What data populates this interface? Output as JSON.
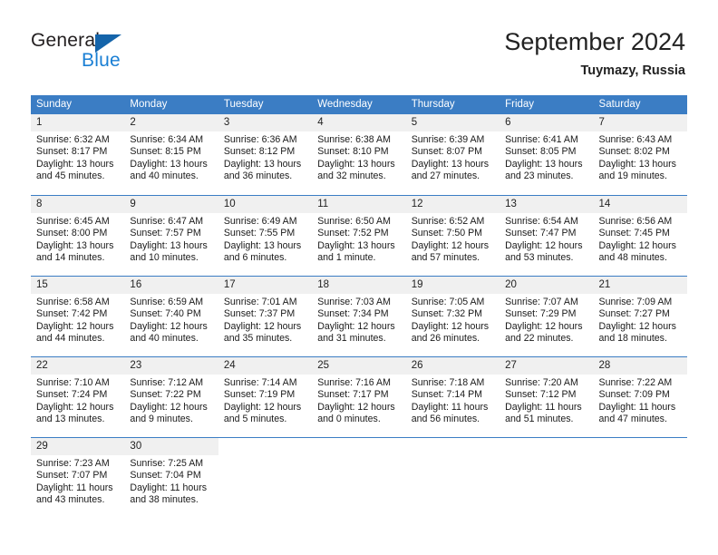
{
  "brand": {
    "name_part1": "General",
    "name_part2": "Blue",
    "triangle_icon": "triangle-logo-icon",
    "color_dark": "#231f20",
    "color_blue": "#1a7fd4"
  },
  "header": {
    "title": "September 2024",
    "subtitle": "Tuymazy, Russia"
  },
  "theme": {
    "header_bar": "#3b7dc4",
    "day_band": "#f0f0f0",
    "text": "#1a1a1a"
  },
  "weekdays": [
    "Sunday",
    "Monday",
    "Tuesday",
    "Wednesday",
    "Thursday",
    "Friday",
    "Saturday"
  ],
  "weeks": [
    [
      {
        "day": "1",
        "sunrise": "Sunrise: 6:32 AM",
        "sunset": "Sunset: 8:17 PM",
        "daylight1": "Daylight: 13 hours",
        "daylight2": "and 45 minutes."
      },
      {
        "day": "2",
        "sunrise": "Sunrise: 6:34 AM",
        "sunset": "Sunset: 8:15 PM",
        "daylight1": "Daylight: 13 hours",
        "daylight2": "and 40 minutes."
      },
      {
        "day": "3",
        "sunrise": "Sunrise: 6:36 AM",
        "sunset": "Sunset: 8:12 PM",
        "daylight1": "Daylight: 13 hours",
        "daylight2": "and 36 minutes."
      },
      {
        "day": "4",
        "sunrise": "Sunrise: 6:38 AM",
        "sunset": "Sunset: 8:10 PM",
        "daylight1": "Daylight: 13 hours",
        "daylight2": "and 32 minutes."
      },
      {
        "day": "5",
        "sunrise": "Sunrise: 6:39 AM",
        "sunset": "Sunset: 8:07 PM",
        "daylight1": "Daylight: 13 hours",
        "daylight2": "and 27 minutes."
      },
      {
        "day": "6",
        "sunrise": "Sunrise: 6:41 AM",
        "sunset": "Sunset: 8:05 PM",
        "daylight1": "Daylight: 13 hours",
        "daylight2": "and 23 minutes."
      },
      {
        "day": "7",
        "sunrise": "Sunrise: 6:43 AM",
        "sunset": "Sunset: 8:02 PM",
        "daylight1": "Daylight: 13 hours",
        "daylight2": "and 19 minutes."
      }
    ],
    [
      {
        "day": "8",
        "sunrise": "Sunrise: 6:45 AM",
        "sunset": "Sunset: 8:00 PM",
        "daylight1": "Daylight: 13 hours",
        "daylight2": "and 14 minutes."
      },
      {
        "day": "9",
        "sunrise": "Sunrise: 6:47 AM",
        "sunset": "Sunset: 7:57 PM",
        "daylight1": "Daylight: 13 hours",
        "daylight2": "and 10 minutes."
      },
      {
        "day": "10",
        "sunrise": "Sunrise: 6:49 AM",
        "sunset": "Sunset: 7:55 PM",
        "daylight1": "Daylight: 13 hours",
        "daylight2": "and 6 minutes."
      },
      {
        "day": "11",
        "sunrise": "Sunrise: 6:50 AM",
        "sunset": "Sunset: 7:52 PM",
        "daylight1": "Daylight: 13 hours",
        "daylight2": "and 1 minute."
      },
      {
        "day": "12",
        "sunrise": "Sunrise: 6:52 AM",
        "sunset": "Sunset: 7:50 PM",
        "daylight1": "Daylight: 12 hours",
        "daylight2": "and 57 minutes."
      },
      {
        "day": "13",
        "sunrise": "Sunrise: 6:54 AM",
        "sunset": "Sunset: 7:47 PM",
        "daylight1": "Daylight: 12 hours",
        "daylight2": "and 53 minutes."
      },
      {
        "day": "14",
        "sunrise": "Sunrise: 6:56 AM",
        "sunset": "Sunset: 7:45 PM",
        "daylight1": "Daylight: 12 hours",
        "daylight2": "and 48 minutes."
      }
    ],
    [
      {
        "day": "15",
        "sunrise": "Sunrise: 6:58 AM",
        "sunset": "Sunset: 7:42 PM",
        "daylight1": "Daylight: 12 hours",
        "daylight2": "and 44 minutes."
      },
      {
        "day": "16",
        "sunrise": "Sunrise: 6:59 AM",
        "sunset": "Sunset: 7:40 PM",
        "daylight1": "Daylight: 12 hours",
        "daylight2": "and 40 minutes."
      },
      {
        "day": "17",
        "sunrise": "Sunrise: 7:01 AM",
        "sunset": "Sunset: 7:37 PM",
        "daylight1": "Daylight: 12 hours",
        "daylight2": "and 35 minutes."
      },
      {
        "day": "18",
        "sunrise": "Sunrise: 7:03 AM",
        "sunset": "Sunset: 7:34 PM",
        "daylight1": "Daylight: 12 hours",
        "daylight2": "and 31 minutes."
      },
      {
        "day": "19",
        "sunrise": "Sunrise: 7:05 AM",
        "sunset": "Sunset: 7:32 PM",
        "daylight1": "Daylight: 12 hours",
        "daylight2": "and 26 minutes."
      },
      {
        "day": "20",
        "sunrise": "Sunrise: 7:07 AM",
        "sunset": "Sunset: 7:29 PM",
        "daylight1": "Daylight: 12 hours",
        "daylight2": "and 22 minutes."
      },
      {
        "day": "21",
        "sunrise": "Sunrise: 7:09 AM",
        "sunset": "Sunset: 7:27 PM",
        "daylight1": "Daylight: 12 hours",
        "daylight2": "and 18 minutes."
      }
    ],
    [
      {
        "day": "22",
        "sunrise": "Sunrise: 7:10 AM",
        "sunset": "Sunset: 7:24 PM",
        "daylight1": "Daylight: 12 hours",
        "daylight2": "and 13 minutes."
      },
      {
        "day": "23",
        "sunrise": "Sunrise: 7:12 AM",
        "sunset": "Sunset: 7:22 PM",
        "daylight1": "Daylight: 12 hours",
        "daylight2": "and 9 minutes."
      },
      {
        "day": "24",
        "sunrise": "Sunrise: 7:14 AM",
        "sunset": "Sunset: 7:19 PM",
        "daylight1": "Daylight: 12 hours",
        "daylight2": "and 5 minutes."
      },
      {
        "day": "25",
        "sunrise": "Sunrise: 7:16 AM",
        "sunset": "Sunset: 7:17 PM",
        "daylight1": "Daylight: 12 hours",
        "daylight2": "and 0 minutes."
      },
      {
        "day": "26",
        "sunrise": "Sunrise: 7:18 AM",
        "sunset": "Sunset: 7:14 PM",
        "daylight1": "Daylight: 11 hours",
        "daylight2": "and 56 minutes."
      },
      {
        "day": "27",
        "sunrise": "Sunrise: 7:20 AM",
        "sunset": "Sunset: 7:12 PM",
        "daylight1": "Daylight: 11 hours",
        "daylight2": "and 51 minutes."
      },
      {
        "day": "28",
        "sunrise": "Sunrise: 7:22 AM",
        "sunset": "Sunset: 7:09 PM",
        "daylight1": "Daylight: 11 hours",
        "daylight2": "and 47 minutes."
      }
    ],
    [
      {
        "day": "29",
        "sunrise": "Sunrise: 7:23 AM",
        "sunset": "Sunset: 7:07 PM",
        "daylight1": "Daylight: 11 hours",
        "daylight2": "and 43 minutes."
      },
      {
        "day": "30",
        "sunrise": "Sunrise: 7:25 AM",
        "sunset": "Sunset: 7:04 PM",
        "daylight1": "Daylight: 11 hours",
        "daylight2": "and 38 minutes."
      },
      {
        "day": "",
        "sunrise": "",
        "sunset": "",
        "daylight1": "",
        "daylight2": ""
      },
      {
        "day": "",
        "sunrise": "",
        "sunset": "",
        "daylight1": "",
        "daylight2": ""
      },
      {
        "day": "",
        "sunrise": "",
        "sunset": "",
        "daylight1": "",
        "daylight2": ""
      },
      {
        "day": "",
        "sunrise": "",
        "sunset": "",
        "daylight1": "",
        "daylight2": ""
      },
      {
        "day": "",
        "sunrise": "",
        "sunset": "",
        "daylight1": "",
        "daylight2": ""
      }
    ]
  ]
}
